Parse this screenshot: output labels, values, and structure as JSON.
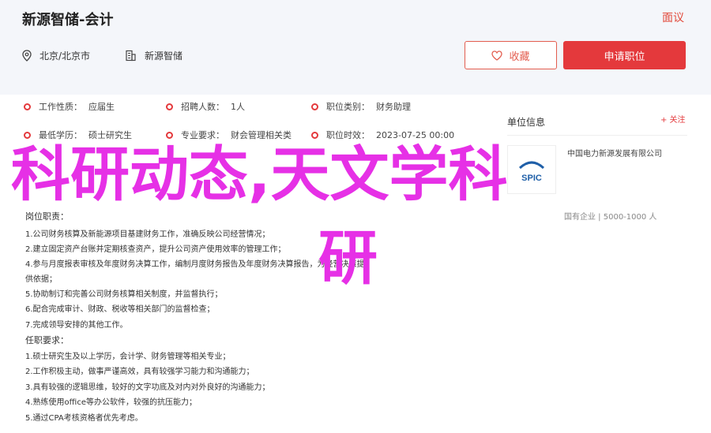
{
  "header": {
    "title": "新源智储-会计",
    "report": "面议",
    "location": "北京/北京市",
    "company": "新源智储",
    "favorite_label": "收藏",
    "apply_label": "申请职位"
  },
  "attributes": [
    {
      "label": "工作性质：",
      "value": "应届生"
    },
    {
      "label": "招聘人数：",
      "value": "1人"
    },
    {
      "label": "职位类别：",
      "value": "财务助理"
    },
    {
      "label": "最低学历：",
      "value": "硕士研究生"
    },
    {
      "label": "专业要求：",
      "value": "财会管理相关类"
    },
    {
      "label": "职位时效：",
      "value": "2023-07-25 00:00"
    }
  ],
  "sidebar": {
    "title": "单位信息",
    "follow": "+ 关注",
    "company_name": "中国电力新源发展有限公司",
    "company_meta": "国有企业 | 5000-1000 人",
    "logo_text": "SPIC"
  },
  "duties": {
    "heading": "岗位职责：",
    "lines": [
      "1.公司财务核算及新能源项目基建财务工作，准确反映公司经营情况；",
      "2.建立固定资产台账并定期核查资产，提升公司资产使用效率的管理工作；",
      "4.参与月度报表审核及年度财务决算工作，编制月度财务报告及年度财务决算报告，为经营决策提",
      "供依据；",
      "5.协助制订和完善公司财务核算相关制度，并监督执行；",
      "6.配合完成审计、财政、税收等相关部门的监督检查；",
      "7.完成领导安排的其他工作。"
    ]
  },
  "requirements": {
    "heading": "任职要求：",
    "lines": [
      "1.硕士研究生及以上学历，会计学、财务管理等相关专业；",
      "2.工作积极主动，做事严谨高效，具有较强学习能力和沟通能力；",
      "3.具有较强的逻辑思维，较好的文字功底及对内对外良好的沟通能力；",
      "4.熟练使用office等办公软件，较强的抗压能力；",
      "5.通过CPA考核资格者优先考虑。"
    ]
  },
  "overlay": {
    "line1": "科研动态,天文学科",
    "line2": "研"
  },
  "colors": {
    "accent": "#e4393c",
    "overlay": "#e630e6",
    "header_bg": "#f4f6fa"
  }
}
